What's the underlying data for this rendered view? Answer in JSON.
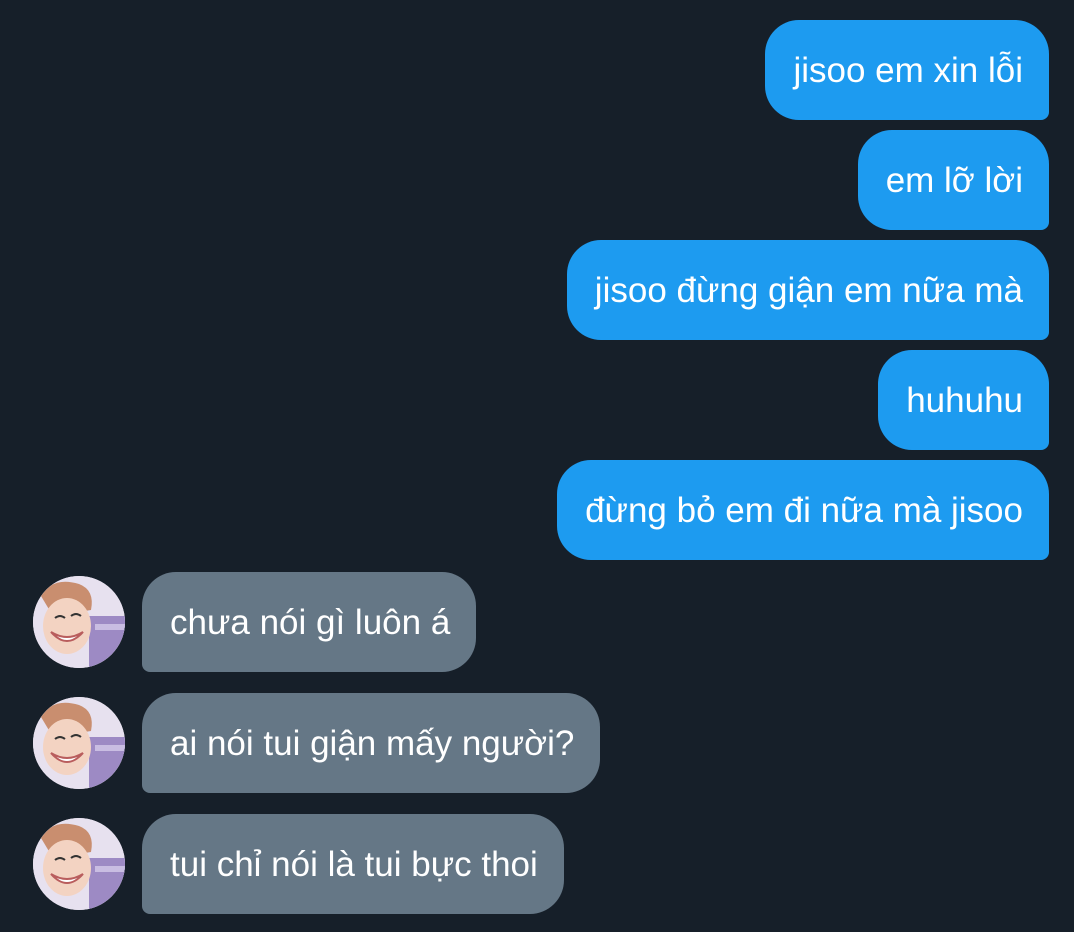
{
  "messages": {
    "outgoing": [
      {
        "text": "jisoo em xin lỗi"
      },
      {
        "text": "em lỡ lời"
      },
      {
        "text": "jisoo đừng giận em nữa mà"
      },
      {
        "text": "huhuhu"
      },
      {
        "text": "đừng bỏ em đi nữa mà jisoo"
      }
    ],
    "incoming": [
      {
        "text": "chưa nói gì luôn á"
      },
      {
        "text": "ai nói tui giận mấy người?"
      },
      {
        "text": "tui chỉ nói là tui bực thoi"
      }
    ]
  },
  "colors": {
    "background": "#161f29",
    "outgoing_bubble": "#1d9bf0",
    "incoming_bubble": "#657786",
    "text": "#ffffff"
  },
  "icons": {
    "avatar": "user-avatar-photo"
  }
}
